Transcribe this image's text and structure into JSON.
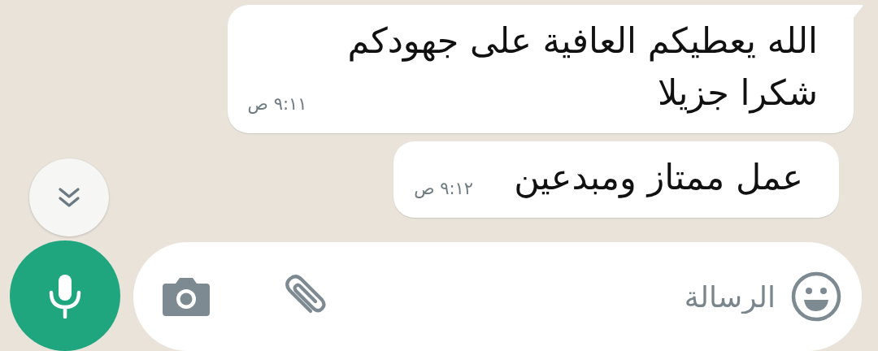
{
  "messages": [
    {
      "text": "الله يعطيكم العافية على جهودكم\nشكرا جزيلا",
      "time": "٩:١١ ص",
      "tail": true
    },
    {
      "text": "عمل ممتاز ومبدعين",
      "time": "٩:١٢ ص",
      "tail": false
    }
  ],
  "composer": {
    "placeholder": "الرسالة"
  }
}
